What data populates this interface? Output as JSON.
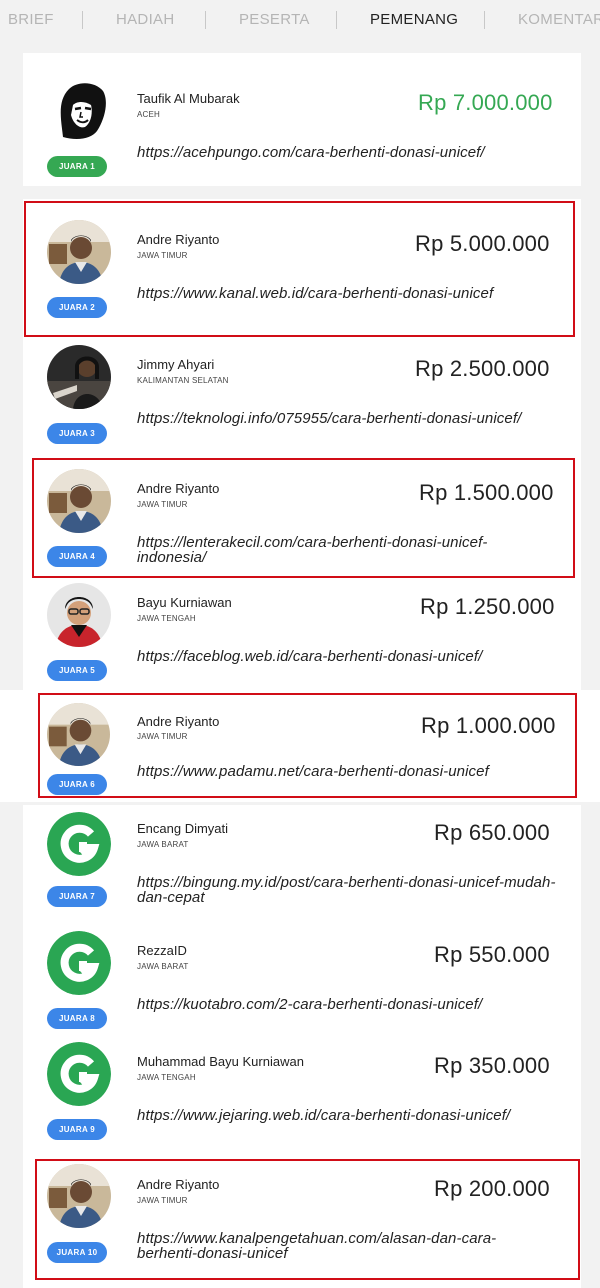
{
  "tabs": [
    {
      "label": "BRIEF"
    },
    {
      "label": "HADIAH"
    },
    {
      "label": "PESERTA"
    },
    {
      "label": "PEMENANG",
      "active": true
    },
    {
      "label": "KOMENTAR"
    }
  ],
  "winners": [
    {
      "badge": "JUARA 1",
      "name": "Taufik Al Mubarak",
      "region": "ACEH",
      "prize": "Rp 7.000.000",
      "url": "https://acehpungo.com/cara-berhenti-donasi-unicef/",
      "avatar": "sketch-portrait"
    },
    {
      "badge": "JUARA 2",
      "name": "Andre Riyanto",
      "region": "JAWA TIMUR",
      "prize": "Rp 5.000.000",
      "url": "https://www.kanal.web.id/cara-berhenti-donasi-unicef",
      "avatar": "photo-man"
    },
    {
      "badge": "JUARA 3",
      "name": "Jimmy Ahyari",
      "region": "KALIMANTAN SELATAN",
      "prize": "Rp 2.500.000",
      "url": "https://teknologi.info/075955/cara-berhenti-donasi-unicef/",
      "avatar": "photo-woman"
    },
    {
      "badge": "JUARA 4",
      "name": "Andre Riyanto",
      "region": "JAWA TIMUR",
      "prize": "Rp 1.500.000",
      "url": "https://lenterakecil.com/cara-berhenti-donasi-unicef-indonesia/",
      "avatar": "photo-man"
    },
    {
      "badge": "JUARA 5",
      "name": "Bayu Kurniawan",
      "region": "JAWA TENGAH",
      "prize": "Rp 1.250.000",
      "url": "https://faceblog.web.id/cara-berhenti-donasi-unicef/",
      "avatar": "photo-boy"
    },
    {
      "badge": "JUARA 6",
      "name": "Andre Riyanto",
      "region": "JAWA TIMUR",
      "prize": "Rp 1.000.000",
      "url": "https://www.padamu.net/cara-berhenti-donasi-unicef",
      "avatar": "photo-man"
    },
    {
      "badge": "JUARA 7",
      "name": "Encang Dimyati",
      "region": "JAWA BARAT",
      "prize": "Rp 650.000",
      "url": "https://bingung.my.id/post/cara-berhenti-donasi-unicef-mudah-dan-cepat",
      "avatar": "g-logo"
    },
    {
      "badge": "JUARA 8",
      "name": "RezzaID",
      "region": "JAWA BARAT",
      "prize": "Rp 550.000",
      "url": "https://kuotabro.com/2-cara-berhenti-donasi-unicef/",
      "avatar": "g-logo"
    },
    {
      "badge": "JUARA 9",
      "name": "Muhammad Bayu Kurniawan",
      "region": "JAWA TENGAH",
      "prize": "Rp 350.000",
      "url": "https://www.jejaring.web.id/cara-berhenti-donasi-unicef/",
      "avatar": "g-logo"
    },
    {
      "badge": "JUARA 10",
      "name": "Andre Riyanto",
      "region": "JAWA TIMUR",
      "prize": "Rp 200.000",
      "url": "https://www.kanalpengetahuan.com/alasan-dan-cara-berhenti-donasi-unicef",
      "avatar": "photo-man"
    }
  ],
  "colors": {
    "accent_green": "#35a853",
    "badge_blue": "#3c86e8",
    "highlight_red": "#d10d17"
  }
}
